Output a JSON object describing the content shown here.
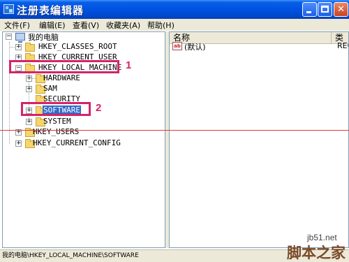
{
  "window": {
    "title": "注册表编辑器",
    "min_glyph": "",
    "max_glyph": "",
    "close_glyph": "✕"
  },
  "menu": [
    {
      "label": "文件(F)"
    },
    {
      "label": "编辑(E)"
    },
    {
      "label": "查看(V)"
    },
    {
      "label": "收藏夹(A)"
    },
    {
      "label": "帮助(H)"
    }
  ],
  "tree": {
    "root": "我的电脑",
    "hkcr": "HKEY_CLASSES_ROOT",
    "hkcu": "HKEY_CURRENT_USER",
    "hklm": "HKEY_LOCAL_MACHINE",
    "hardware": "HARDWARE",
    "sam": "SAM",
    "security": "SECURITY",
    "software": "SOFTWARE",
    "system": "SYSTEM",
    "hku": "HKEY_USERS",
    "hkcc": "HKEY_CURRENT_CONFIG",
    "expand_plus": "+",
    "expand_minus": "−"
  },
  "annotations": {
    "marker1": "1",
    "marker2": "2",
    "highlight_color": "#d4246a"
  },
  "list": {
    "columns": [
      "名称",
      "类"
    ],
    "rows": [
      {
        "name": "(默认)",
        "type": "REG",
        "icon": "ab"
      }
    ]
  },
  "status": {
    "path": "我的电脑\\HKEY_LOCAL_MACHINE\\SOFTWARE"
  },
  "watermark": {
    "site": "jb51.net",
    "name": "脚本之家"
  }
}
